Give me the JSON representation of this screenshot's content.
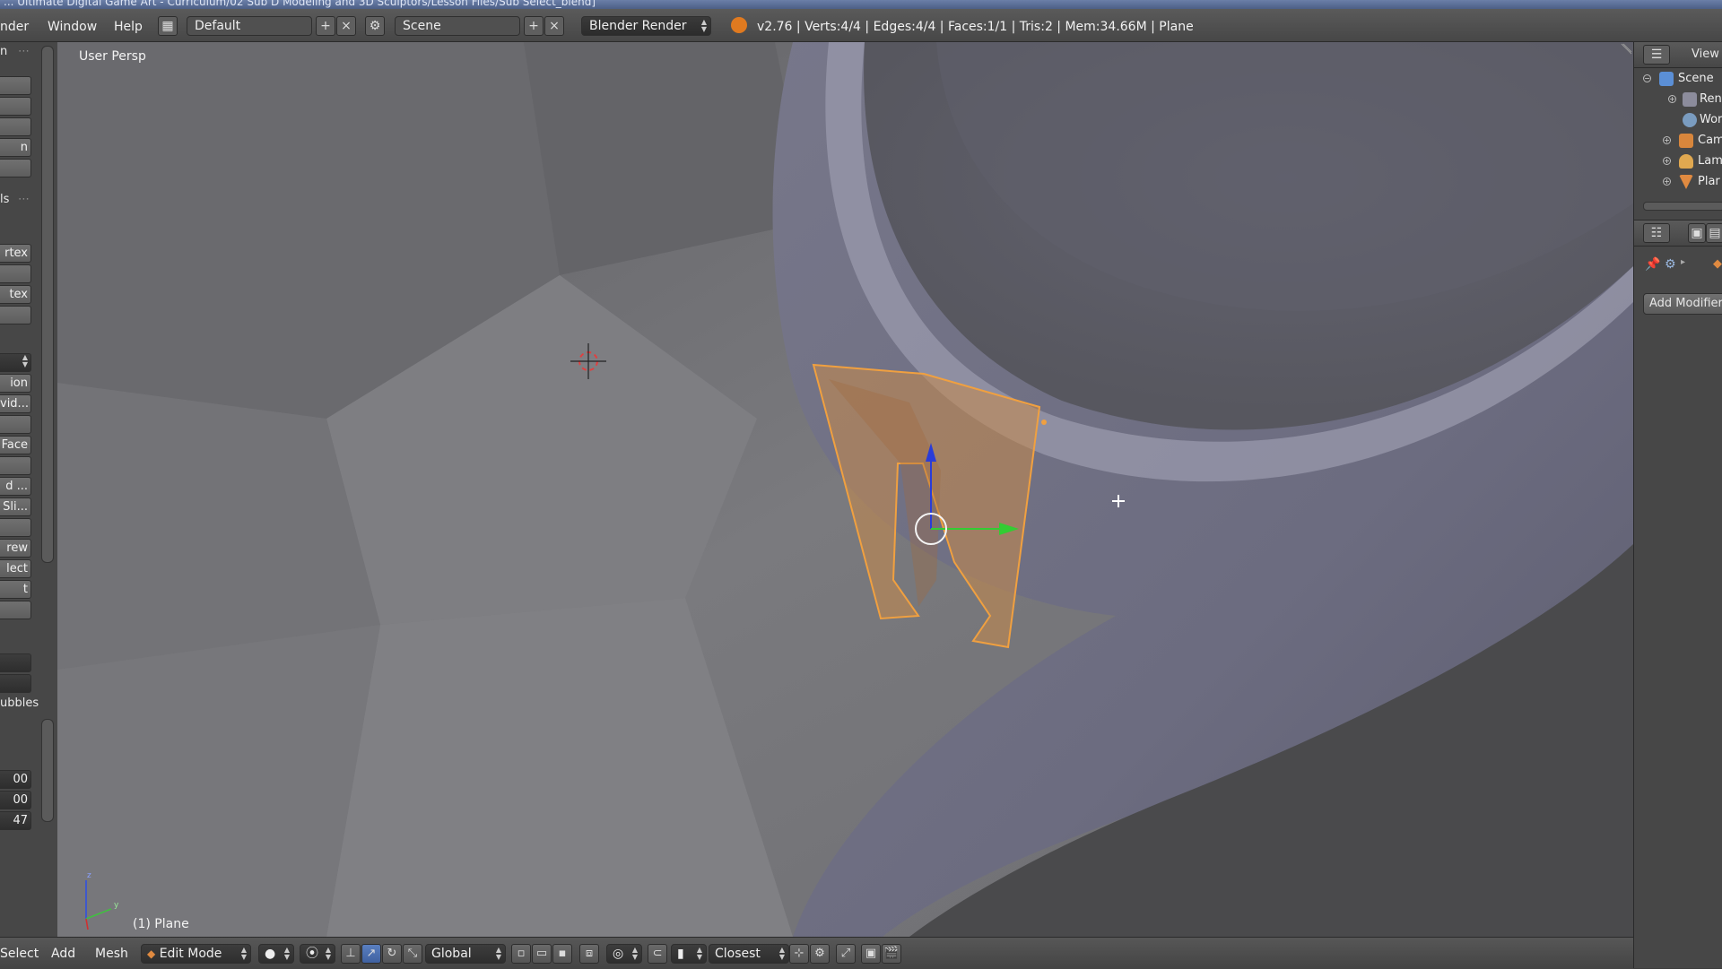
{
  "window": {
    "title_fragment": "... Ultimate Digital Game Art - Curriculum/02 Sub D Modeling and 3D Sculptors/Lesson Files/Sub Select_blend]"
  },
  "header": {
    "menus": [
      "nder",
      "Window",
      "Help"
    ],
    "layout_name": "Default",
    "scene_name": "Scene",
    "render_engine": "Blender Render",
    "stats": "v2.76 | Verts:4/4 | Edges:4/4 | Faces:1/1 | Tris:2 | Mem:34.66M | Plane"
  },
  "toolshelf": {
    "top_label": "n",
    "buttons_group1": [
      "",
      "",
      "",
      "n",
      ""
    ],
    "section_label": "ls",
    "buttons_group2": [
      "rtex",
      "",
      "tex",
      ""
    ],
    "buttons_group3": [
      "",
      "ion",
      "vid...",
      "",
      "Face",
      "",
      "d ...",
      "Sli...",
      "",
      "rew",
      "lect",
      "t",
      ""
    ],
    "dropdowns": [
      "",
      ""
    ],
    "label_bubbles": "ubbles",
    "numeric_fields": [
      "00",
      "00",
      "47"
    ]
  },
  "viewport": {
    "view_name": "User Persp",
    "object_label": "(1) Plane",
    "axis_x": "x",
    "axis_y": "y",
    "axis_z": "z"
  },
  "outliner": {
    "view_label": "View",
    "items": [
      {
        "label": "Scene",
        "icon": "scene-icon"
      },
      {
        "label": "Ren",
        "icon": "render-layers-icon"
      },
      {
        "label": "Wor",
        "icon": "world-icon"
      },
      {
        "label": "Cam",
        "icon": "camera-icon"
      },
      {
        "label": "Lam",
        "icon": "lamp-icon"
      },
      {
        "label": "Plar",
        "icon": "mesh-icon"
      }
    ]
  },
  "properties": {
    "add_modifier_label": "Add Modifier"
  },
  "footer": {
    "menus": [
      "Select",
      "Add",
      "Mesh"
    ],
    "mode": "Edit Mode",
    "orientation": "Global",
    "snap_target": "Closest"
  },
  "colors": {
    "selection_orange": "#f0a040",
    "gizmo_x": "#33cc33",
    "gizmo_z": "#2a3cd8",
    "panel_bg": "#474747"
  }
}
